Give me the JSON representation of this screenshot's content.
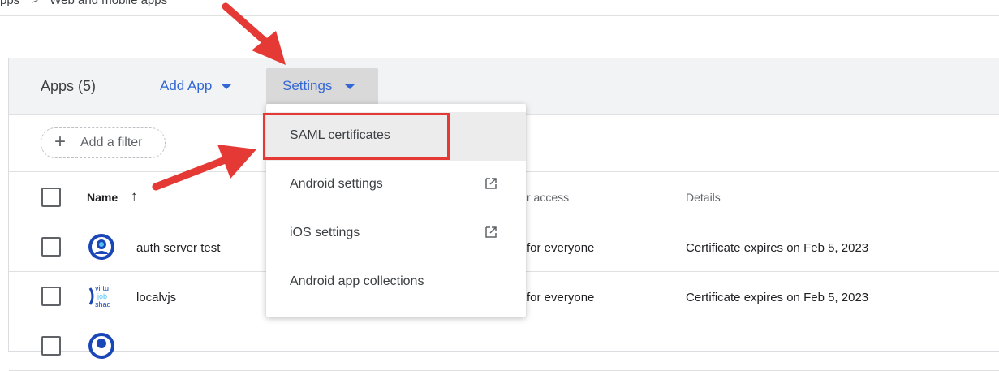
{
  "breadcrumb": {
    "items": [
      "pps",
      "Web and mobile apps"
    ],
    "separator": ">"
  },
  "toolbar": {
    "apps_count": "Apps (5)",
    "add_app": "Add App",
    "settings": "Settings"
  },
  "filter": {
    "add_label": "Add a filter"
  },
  "table": {
    "headers": {
      "name": "Name",
      "access": "r access",
      "details": "Details"
    },
    "rows": [
      {
        "name": "auth server test",
        "access": "for everyone",
        "details": "Certificate expires on Feb 5, 2023",
        "icon": "blue-user-circle-icon"
      },
      {
        "name": "localvjs",
        "access": "for everyone",
        "details": "Certificate expires on Feb 5, 2023",
        "icon": "virtual-job-shadow-logo",
        "logo_text": [
          "virtu",
          "job",
          "shad"
        ]
      }
    ]
  },
  "settings_menu": {
    "items": [
      {
        "label": "SAML certificates",
        "external": false,
        "highlighted": true
      },
      {
        "label": "Android settings",
        "external": true
      },
      {
        "label": "iOS settings",
        "external": true
      },
      {
        "label": "Android app collections",
        "external": false
      }
    ]
  },
  "colors": {
    "accent": "#3367d6",
    "annotation": "#e53935"
  }
}
